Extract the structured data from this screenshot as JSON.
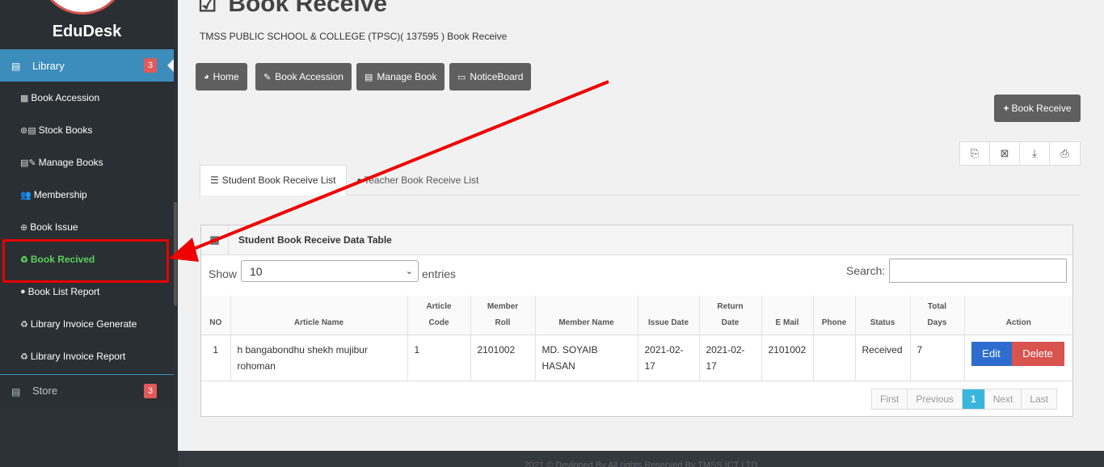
{
  "sidebar": {
    "brand": "EduDesk",
    "library": {
      "label": "Library",
      "badge": "3"
    },
    "items": [
      {
        "label": "Book Accession",
        "icon": "▦"
      },
      {
        "label": "Stock Books",
        "icon": "⊛▤"
      },
      {
        "label": "Manage Books",
        "icon": "▤✎"
      },
      {
        "label": "Membership",
        "icon": "👥"
      },
      {
        "label": "Book Issue",
        "icon": "⊕"
      },
      {
        "label": "Book Recived",
        "icon": "♻"
      },
      {
        "label": "Book List Report",
        "icon": "●"
      },
      {
        "label": "Library Invoice Generate",
        "icon": "♻"
      },
      {
        "label": "Library Invoice Report",
        "icon": "♻"
      }
    ],
    "store": {
      "label": "Store",
      "badge": "3"
    }
  },
  "page": {
    "title": "Book Receive",
    "subtitle": "TMSS PUBLIC SCHOOL & COLLEGE (TPSC)( 137595 ) Book Receive"
  },
  "nav": {
    "home": "Home",
    "accession": "Book Accession",
    "manage": "Manage Book",
    "notice": "NoticeBoard"
  },
  "receive_button": "Book Receive",
  "tabs": {
    "student": "Student Book Receive List",
    "teacher": "Teacher Book Receive List"
  },
  "panel": {
    "title": "Student Book Receive Data Table",
    "show": "Show",
    "entries_value": "10",
    "entries": "entries",
    "search": "Search:"
  },
  "table": {
    "headers": {
      "no": "NO",
      "article_name": "Article Name",
      "article_code_1": "Article",
      "article_code_2": "Code",
      "member_roll_1": "Member",
      "member_roll_2": "Roll",
      "member_name": "Member Name",
      "issue_date": "Issue Date",
      "return_date_1": "Return",
      "return_date_2": "Date",
      "email": "E Mail",
      "phone": "Phone",
      "status": "Status",
      "total_days_1": "Total",
      "total_days_2": "Days",
      "action": "Action"
    },
    "row": {
      "no": "1",
      "article_name": "h bangabondhu shekh mujibur rohoman",
      "article_code": "1",
      "member_roll": "2101002",
      "member_name": "MD. SOYAIB HASAN",
      "issue_date": "2021-02-17",
      "return_date": "2021-02-17",
      "email": "2101002",
      "phone": "",
      "status": "Received",
      "total_days": "7",
      "edit": "Edit",
      "delete": "Delete"
    }
  },
  "pager": {
    "first": "First",
    "previous": "Previous",
    "page": "1",
    "next": "Next",
    "last": "Last"
  },
  "footer": "2021 © Devloped By All rights Reserved By TMSS ICT LTD"
}
